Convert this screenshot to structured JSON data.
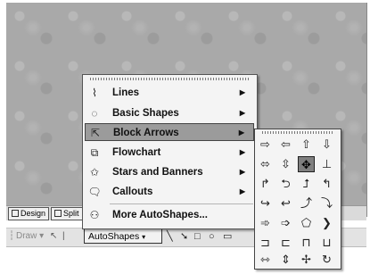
{
  "view_tabs": {
    "design": "Design",
    "split": "Split"
  },
  "drawing_toolbar": {
    "draw_label": "Draw",
    "autoshapes_label": "AutoShapes"
  },
  "autoshapes_menu": {
    "items": [
      {
        "label": "Lines",
        "icon": "lines-icon",
        "submenu": true
      },
      {
        "label": "Basic Shapes",
        "icon": "basic-shapes-icon",
        "submenu": true
      },
      {
        "label": "Block Arrows",
        "icon": "block-arrows-icon",
        "submenu": true,
        "highlighted": true
      },
      {
        "label": "Flowchart",
        "icon": "flowchart-icon",
        "submenu": true
      },
      {
        "label": "Stars and Banners",
        "icon": "stars-banners-icon",
        "submenu": true
      },
      {
        "label": "Callouts",
        "icon": "callouts-icon",
        "submenu": true
      },
      {
        "label": "More AutoShapes...",
        "icon": "more-autoshapes-icon",
        "submenu": false
      }
    ]
  },
  "block_arrows_palette": {
    "shapes": [
      "right-arrow",
      "left-arrow",
      "up-arrow",
      "down-arrow",
      "left-right-arrow",
      "up-down-arrow",
      "quad-arrow",
      "left-right-up-arrow",
      "bent-arrow",
      "u-turn-arrow",
      "left-up-arrow",
      "bent-up-arrow",
      "curved-right-arrow",
      "curved-left-arrow",
      "curved-up-arrow",
      "curved-down-arrow",
      "striped-right-arrow",
      "notched-right-arrow",
      "pentagon",
      "chevron",
      "right-arrow-callout",
      "left-arrow-callout",
      "up-arrow-callout",
      "down-arrow-callout",
      "left-right-arrow-callout",
      "up-down-arrow-callout",
      "quad-arrow-callout",
      "circular-arrow"
    ],
    "selected_index": 6
  }
}
